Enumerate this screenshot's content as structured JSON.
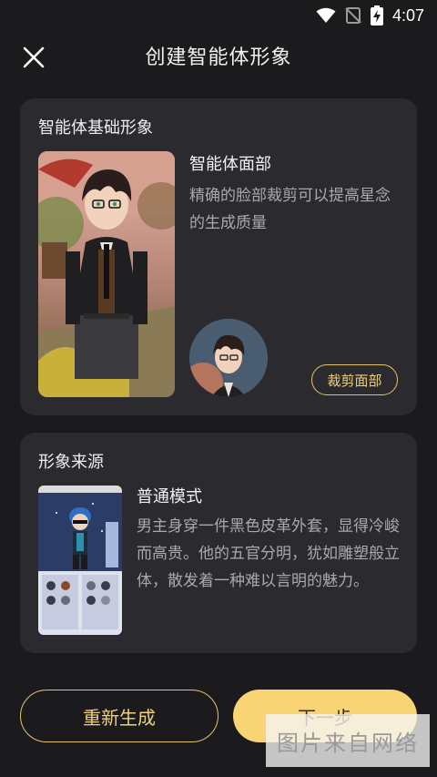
{
  "status_bar": {
    "time": "4:07",
    "icons": [
      "wifi-icon",
      "no-signal-icon",
      "battery-charging-icon"
    ]
  },
  "header": {
    "title": "创建智能体形象",
    "close_icon": "close-icon"
  },
  "base_image_card": {
    "title": "智能体基础形象",
    "face_title": "智能体面部",
    "face_desc": "精确的脸部裁剪可以提高星念的生成质量",
    "crop_button": "裁剪面部"
  },
  "source_card": {
    "title": "形象来源",
    "mode_title": "普通模式",
    "mode_desc": "男主身穿一件黑色皮革外套，显得冷峻而高贵。他的五官分明，犹如雕塑般立体，散发着一种难以言明的魅力。"
  },
  "buttons": {
    "regenerate": "重新生成",
    "next": "下一步"
  },
  "watermark": "图片来自网络",
  "colors": {
    "background": "#1b1b1e",
    "card": "#2b2b2f",
    "accent": "#f8d475"
  }
}
